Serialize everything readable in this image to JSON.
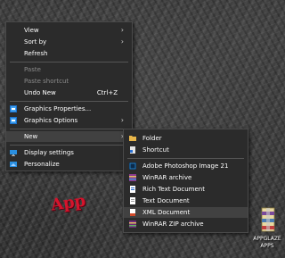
{
  "context_menu": {
    "items": [
      {
        "label": "View",
        "submenu": true
      },
      {
        "label": "Sort by",
        "submenu": true
      },
      {
        "label": "Refresh"
      },
      {
        "label": "Paste",
        "disabled": true
      },
      {
        "label": "Paste shortcut",
        "disabled": true
      },
      {
        "label": "Undo New",
        "shortcut": "Ctrl+Z"
      },
      {
        "label": "Graphics Properties...",
        "icon": "intel-graphics-icon"
      },
      {
        "label": "Graphics Options",
        "icon": "intel-graphics-icon",
        "submenu": true
      },
      {
        "label": "New",
        "submenu": true,
        "highlighted": true
      },
      {
        "label": "Display settings",
        "icon": "display-icon"
      },
      {
        "label": "Personalize",
        "icon": "personalize-icon"
      }
    ]
  },
  "new_submenu": {
    "items": [
      {
        "label": "Folder",
        "icon": "folder-icon"
      },
      {
        "label": "Shortcut",
        "icon": "shortcut-icon"
      },
      {
        "label": "Adobe Photoshop Image 21",
        "icon": "photoshop-icon"
      },
      {
        "label": "WinRAR archive",
        "icon": "winrar-icon"
      },
      {
        "label": "Rich Text Document",
        "icon": "rtf-icon"
      },
      {
        "label": "Text Document",
        "icon": "text-document-icon"
      },
      {
        "label": "XML Document",
        "icon": "xml-icon",
        "highlighted": true
      },
      {
        "label": "WinRAR ZIP archive",
        "icon": "winrar-zip-icon"
      }
    ]
  },
  "desktop": {
    "logo_text": "App",
    "logo_sub": "",
    "icon_label_line1": "APPGLAZE",
    "icon_label_line2": "APPS"
  },
  "colors": {
    "menu_bg": "#2b2b2b",
    "highlight": "#414141",
    "folder": "#e8b64a",
    "photoshop": "#2b8fd8",
    "winrar": "#8b3a8f"
  }
}
